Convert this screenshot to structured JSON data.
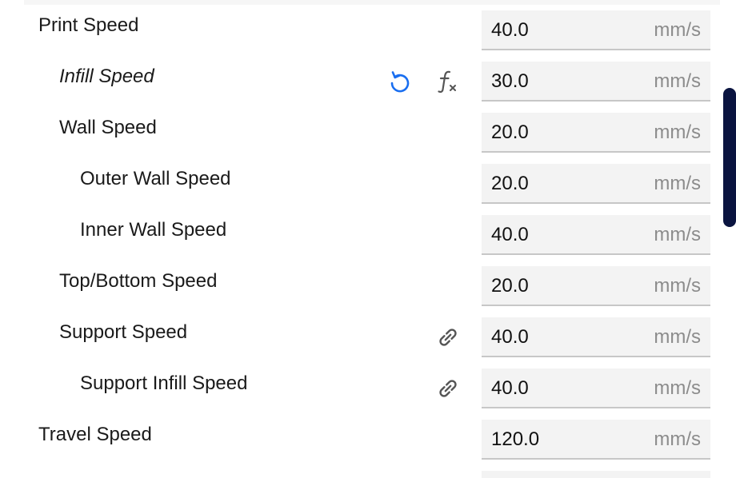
{
  "settings": {
    "rows": [
      {
        "label": "Print Speed",
        "value": "40.0",
        "unit": "mm/s"
      },
      {
        "label": "Infill Speed",
        "value": "30.0",
        "unit": "mm/s"
      },
      {
        "label": "Wall Speed",
        "value": "20.0",
        "unit": "mm/s"
      },
      {
        "label": "Outer Wall Speed",
        "value": "20.0",
        "unit": "mm/s"
      },
      {
        "label": "Inner Wall Speed",
        "value": "40.0",
        "unit": "mm/s"
      },
      {
        "label": "Top/Bottom Speed",
        "value": "20.0",
        "unit": "mm/s"
      },
      {
        "label": "Support Speed",
        "value": "40.0",
        "unit": "mm/s"
      },
      {
        "label": "Support Infill Speed",
        "value": "40.0",
        "unit": "mm/s"
      },
      {
        "label": "Travel Speed",
        "value": "120.0",
        "unit": "mm/s"
      }
    ]
  },
  "icons": {
    "reset": "reset-icon",
    "function": "function-icon",
    "link": "link-icon"
  },
  "colors": {
    "accent_blue": "#196ef0",
    "icon_gray": "#555555",
    "scrollbar": "#0a1440",
    "field_bg": "#f3f3f3"
  }
}
